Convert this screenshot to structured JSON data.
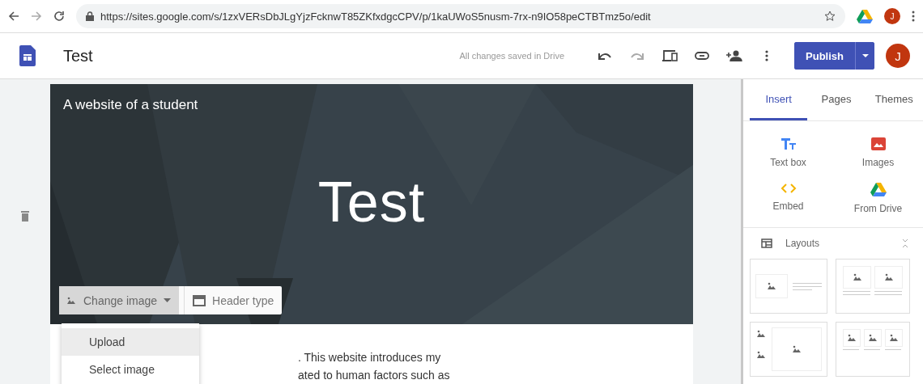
{
  "browser": {
    "url": "https://sites.google.com/s/1zxVERsDbJLgYjzFcknwT85ZKfxdgcCPV/p/1kaUWoS5nusm-7rx-n9IO58peCTBTmz5o/edit",
    "avatar": "J"
  },
  "toolbar": {
    "title": "Test",
    "status": "All changes saved in Drive",
    "publish": "Publish",
    "avatar": "J"
  },
  "header": {
    "site_title": "A website of a student",
    "page_title": "Test",
    "change_image": "Change image",
    "header_type": "Header type"
  },
  "image_menu": [
    {
      "label": "Upload",
      "selected": true
    },
    {
      "label": "Select image",
      "selected": false
    }
  ],
  "body_lines": [
    ". This website introduces my",
    "ated to human factors such as"
  ],
  "sidebar": {
    "tabs": [
      {
        "label": "Insert",
        "selected": true
      },
      {
        "label": "Pages",
        "selected": false
      },
      {
        "label": "Themes",
        "selected": false
      }
    ],
    "items": [
      {
        "kind": "textbox",
        "label": "Text box"
      },
      {
        "kind": "images",
        "label": "Images"
      },
      {
        "kind": "embed",
        "label": "Embed"
      },
      {
        "kind": "drive",
        "label": "From Drive"
      }
    ],
    "layouts": {
      "label": "Layouts",
      "expanded": true
    }
  }
}
